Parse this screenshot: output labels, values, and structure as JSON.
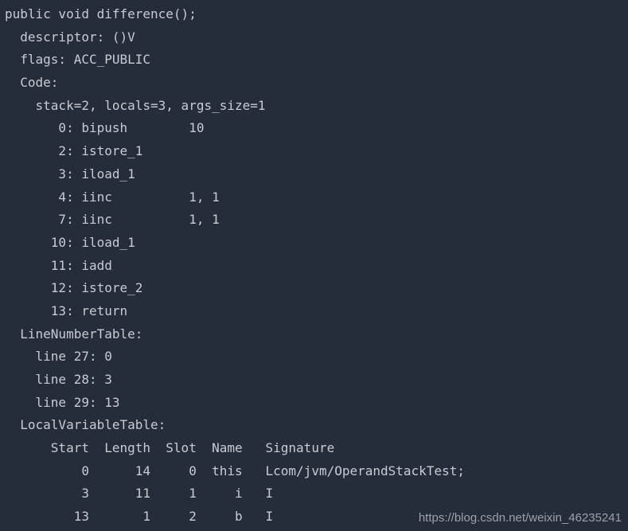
{
  "colors": {
    "background": "#262d3a",
    "text": "#c7ccd4",
    "watermark": "#9aa1ab"
  },
  "listing": {
    "title": "public void difference();",
    "descriptor_line": "  descriptor: ()V",
    "flags_line": "  flags: ACC_PUBLIC",
    "code_label": "  Code:",
    "code_attrs": "    stack=2, locals=3, args_size=1",
    "instructions": [
      {
        "offset": "0",
        "opcode": "bipush",
        "operands": "10"
      },
      {
        "offset": "2",
        "opcode": "istore_1",
        "operands": ""
      },
      {
        "offset": "3",
        "opcode": "iload_1",
        "operands": ""
      },
      {
        "offset": "4",
        "opcode": "iinc",
        "operands": "1, 1"
      },
      {
        "offset": "7",
        "opcode": "iinc",
        "operands": "1, 1"
      },
      {
        "offset": "10",
        "opcode": "iload_1",
        "operands": ""
      },
      {
        "offset": "11",
        "opcode": "iadd",
        "operands": ""
      },
      {
        "offset": "12",
        "opcode": "istore_2",
        "operands": ""
      },
      {
        "offset": "13",
        "opcode": "return",
        "operands": ""
      }
    ],
    "line_number_table": {
      "label": "  LineNumberTable:",
      "entries": [
        {
          "text": "    line 27: 0"
        },
        {
          "text": "    line 28: 3"
        },
        {
          "text": "    line 29: 13"
        }
      ]
    },
    "local_variable_table": {
      "label": "  LocalVariableTable:",
      "headers": [
        "Start",
        "Length",
        "Slot",
        "Name",
        "Signature"
      ],
      "header_line": "      Start  Length  Slot  Name   Signature",
      "rows": [
        {
          "start": "0",
          "length": "14",
          "slot": "0",
          "name": "this",
          "signature": "Lcom/jvm/OperandStackTest;"
        },
        {
          "start": "3",
          "length": "11",
          "slot": "1",
          "name": "i",
          "signature": "I"
        },
        {
          "start": "13",
          "length": "1",
          "slot": "2",
          "name": "b",
          "signature": "I"
        }
      ]
    }
  },
  "watermark": {
    "text": "https://blog.csdn.net/weixin_46235241"
  }
}
